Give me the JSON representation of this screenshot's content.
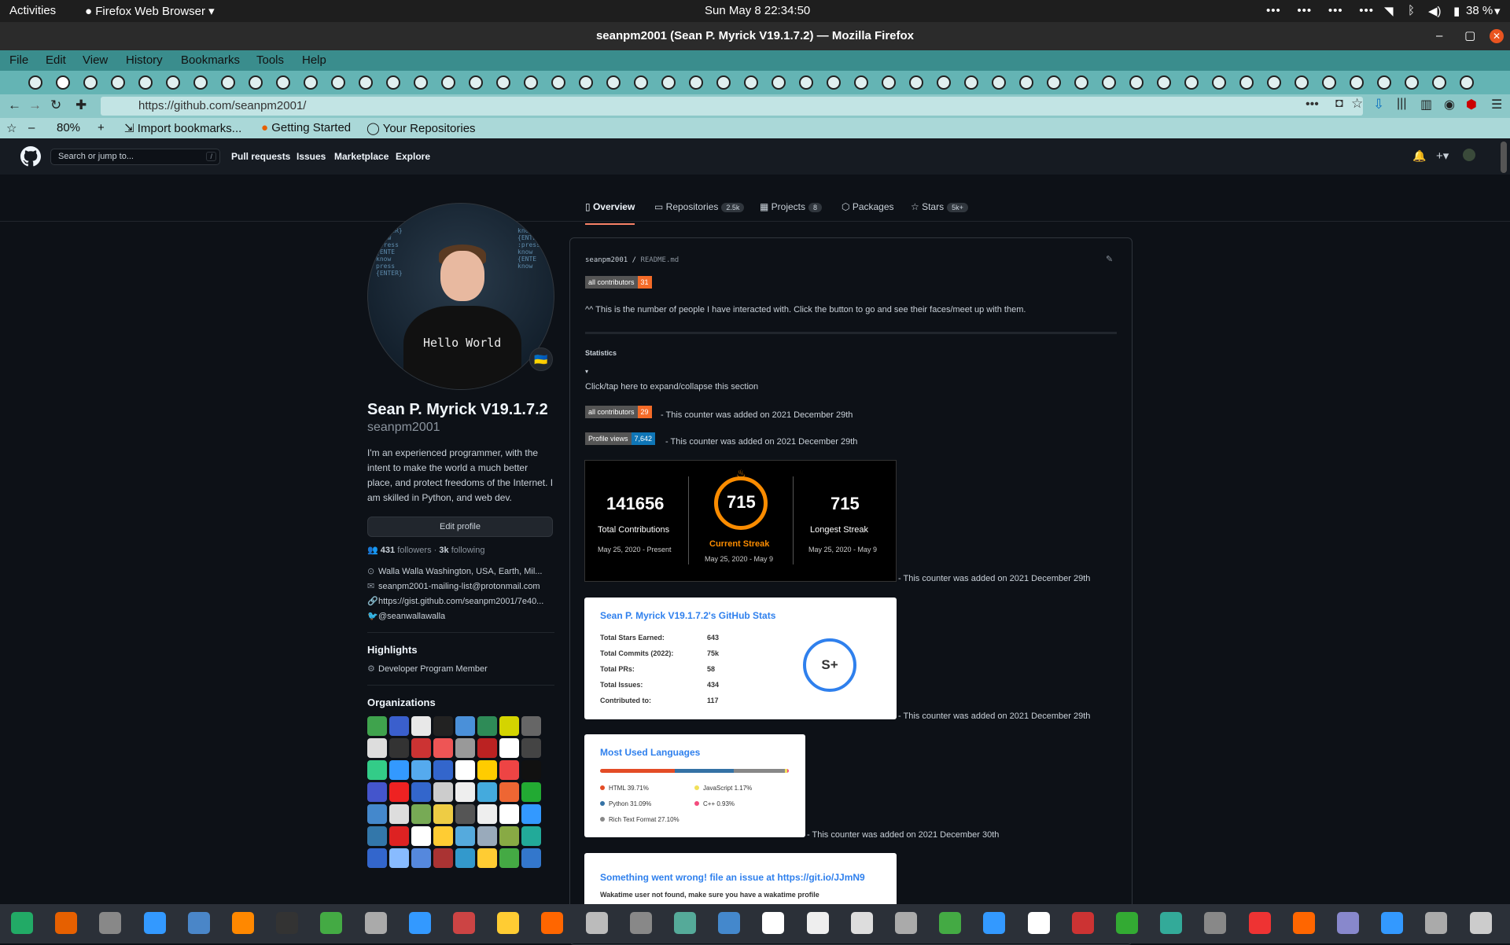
{
  "system": {
    "activities": "Activities",
    "app_menu": "Firefox Web Browser",
    "clock": "Sun May 8  22:34:50",
    "battery": "38 %"
  },
  "window": {
    "title": "seanpm2001 (Sean P. Myrick V19.1.7.2) — Mozilla Firefox"
  },
  "menu": {
    "file": "File",
    "edit": "Edit",
    "view": "View",
    "history": "History",
    "bookmarks": "Bookmarks",
    "tools": "Tools",
    "help": "Help"
  },
  "url": "https://github.com/seanpm2001/",
  "zoom": "80%",
  "bookmarks_bar": {
    "import": "Import bookmarks...",
    "getting_started": "Getting Started",
    "repos": "Your Repositories"
  },
  "gh": {
    "search_placeholder": "Search or jump to...",
    "search_key": "/",
    "nav": [
      "Pull requests",
      "Issues",
      "Marketplace",
      "Explore"
    ]
  },
  "profile_tabs": {
    "overview": "Overview",
    "repositories": "Repositories",
    "repositories_count": "2.5k",
    "projects": "Projects",
    "projects_count": "8",
    "packages": "Packages",
    "stars": "Stars",
    "stars_count": "5k+"
  },
  "profile": {
    "fullname": "Sean P. Myrick V19.1.7.2",
    "login": "seanpm2001",
    "bio": "I'm an experienced programmer, with the intent to make the world a much better place, and protect freedoms of the Internet. I am skilled in Python, and web dev.",
    "edit": "Edit profile",
    "followers": "431",
    "followers_label": "followers",
    "following": "3k",
    "following_label": "following",
    "dot": " · ",
    "location": "Walla Walla Washington, USA, Earth, Mil...",
    "email": "seanpm2001-mailing-list@protonmail.com",
    "website": "https://gist.github.com/seanpm2001/7e40...",
    "twitter": "@seanwallawalla",
    "highlights": "Highlights",
    "highlight_item": "Developer Program Member",
    "organizations": "Organizations",
    "avatar_shirt": "Hello World"
  },
  "readme": {
    "path_user": "seanpm2001",
    "path_sep": " / ",
    "path_file": "README.md",
    "badge1_label": "all contributors",
    "badge1_value": "31",
    "intro": "^^ This is the number of people I have interacted with. Click the button to go and see their faces/meet up with them.",
    "statistics": "Statistics",
    "triangle": "▾",
    "expand": "Click/tap here to expand/collapse this section",
    "badge2_label": "all contributors",
    "badge2_value": "29",
    "badge2_note": "- This counter was added on 2021 December 29th",
    "badge3_label": "Profile views",
    "badge3_value": "7,642",
    "badge3_note": "- This counter was added on 2021 December 29th",
    "streak": {
      "total": "141656",
      "total_label": "Total Contributions",
      "total_dates": "May 25, 2020 - Present",
      "current": "715",
      "current_label": "Current Streak",
      "current_dates": "May 25, 2020 - May 9",
      "longest": "715",
      "longest_label": "Longest Streak",
      "longest_dates": "May 25, 2020 - May 9"
    },
    "streak_note": "- This counter was added on 2021 December 29th",
    "stats": {
      "title": "Sean P. Myrick V19.1.7.2's GitHub Stats",
      "rows": [
        [
          "Total Stars Earned:",
          "643"
        ],
        [
          "Total Commits (2022):",
          "75k"
        ],
        [
          "Total PRs:",
          "58"
        ],
        [
          "Total Issues:",
          "434"
        ],
        [
          "Contributed to:",
          "117"
        ]
      ],
      "grade": "S+"
    },
    "stats_note": "- This counter was added on 2021 December 29th",
    "langs": {
      "title": "Most Used Languages",
      "items": [
        {
          "name": "HTML 39.71%",
          "pct": 39.71,
          "color": "#e34c26"
        },
        {
          "name": "Python 31.09%",
          "pct": 31.09,
          "color": "#3572a5"
        },
        {
          "name": "Rich Text Format 27.10%",
          "pct": 27.1,
          "color": "#888888"
        },
        {
          "name": "JavaScript 1.17%",
          "pct": 1.17,
          "color": "#f1e05a"
        },
        {
          "name": "C++ 0.93%",
          "pct": 0.93,
          "color": "#f34b7d"
        }
      ]
    },
    "langs_note": "- This counter was added on 2021 December 30th",
    "waka_title": "Something went wrong! file an issue at https://git.io/JJmN9",
    "waka_text": "Wakatime user not found, make sure you have a wakatime profile"
  }
}
